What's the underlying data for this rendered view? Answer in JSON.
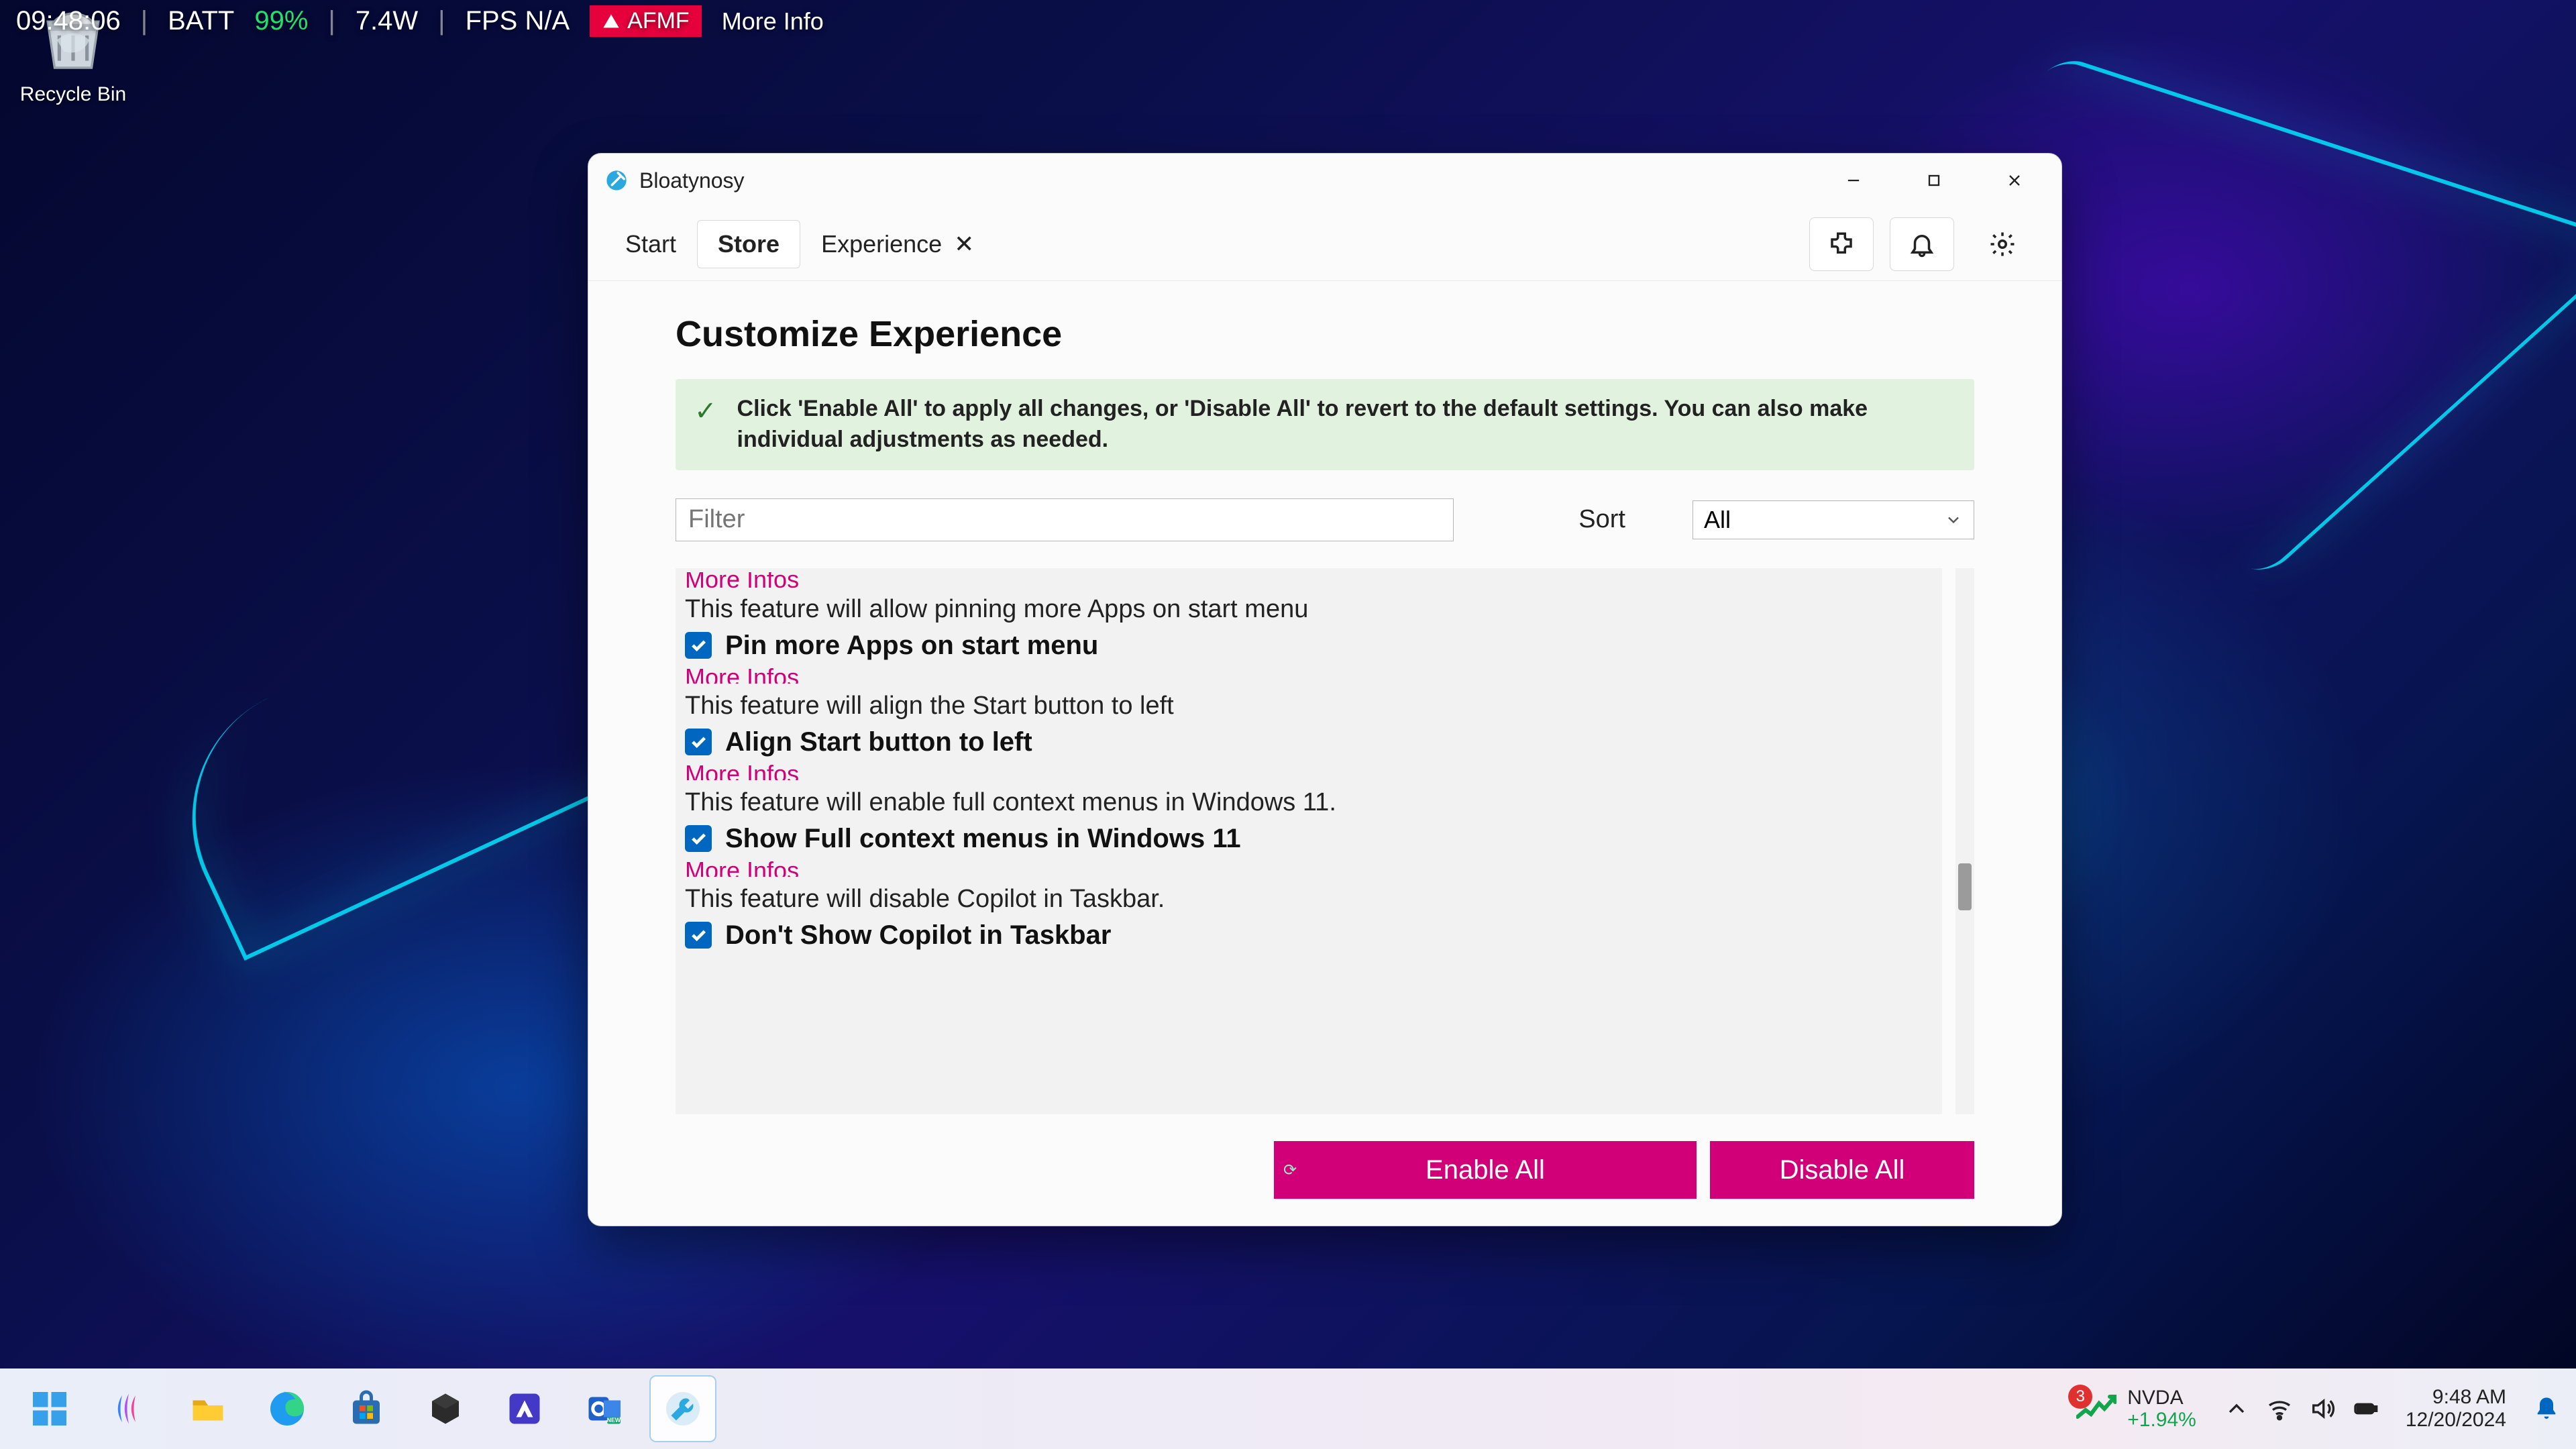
{
  "overlay": {
    "time": "09:48:06",
    "batt_label": "BATT",
    "batt_pct": "99%",
    "watts": "7.4W",
    "fps": "FPS N/A",
    "afmf": "AFMF",
    "moreinfo": "More Info"
  },
  "desktop": {
    "recycle_label": "Recycle Bin"
  },
  "window": {
    "title": "Bloatynosy",
    "tabs": {
      "start": "Start",
      "store": "Store",
      "experience": "Experience"
    },
    "page_title": "Customize Experience",
    "banner": "Click 'Enable All' to apply all changes, or 'Disable All' to revert to the default settings. You can also make individual adjustments as needed.",
    "filter_placeholder": "Filter",
    "sort_label": "Sort",
    "sort_value": "All",
    "more_infos": "More Infos",
    "items": [
      {
        "desc": "This feature will allow pinning more Apps on start menu",
        "title": "Pin more Apps on start menu",
        "checked": true
      },
      {
        "desc": "This feature will align the Start button to left",
        "title": "Align Start button to left",
        "checked": true
      },
      {
        "desc": "This feature will enable full context menus in Windows 11.",
        "title": "Show Full context menus in Windows 11",
        "checked": true
      },
      {
        "desc": "This feature will disable Copilot in Taskbar.",
        "title": "Don't Show Copilot in Taskbar",
        "checked": true
      }
    ],
    "enable_all": "Enable All",
    "disable_all": "Disable All"
  },
  "taskbar": {
    "stock_badge": "3",
    "stock_sym": "NVDA",
    "stock_pct": "+1.94%",
    "time": "9:48 AM",
    "date": "12/20/2024"
  }
}
